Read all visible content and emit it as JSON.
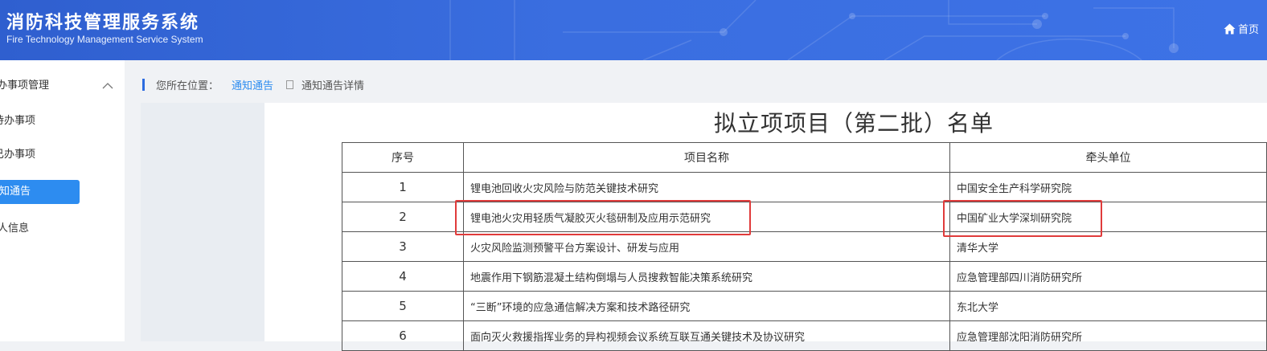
{
  "header": {
    "title": "消防科技管理服务系统",
    "subtitle": "Fire Technology Management Service System",
    "home_label": "首页",
    "home_icon": "home-icon"
  },
  "sidebar": {
    "group_label": "办事项管理",
    "items": [
      {
        "label": "待办事项",
        "active": false
      },
      {
        "label": "已办事项",
        "active": false
      },
      {
        "label": "通知通告",
        "active": true
      },
      {
        "label": "个人信息",
        "active": false
      }
    ],
    "visible_labels": [
      "办事项管理",
      "待办事项",
      "已办事项",
      "知通告",
      "人信息"
    ]
  },
  "breadcrumb": {
    "prefix": "您所在位置：",
    "link": "通知通告",
    "current": "通知通告详情"
  },
  "document": {
    "title": "拟立项项目（第二批）名单",
    "table": {
      "headers": [
        "序号",
        "项目名称",
        "牵头单位"
      ],
      "rows": [
        {
          "no": "1",
          "name": "锂电池回收火灾风险与防范关键技术研究",
          "org": "中国安全生产科学研究院"
        },
        {
          "no": "2",
          "name": "锂电池火灾用轻质气凝胶灭火毯研制及应用示范研究",
          "org": "中国矿业大学深圳研究院"
        },
        {
          "no": "3",
          "name": "火灾风险监测预警平台方案设计、研发与应用",
          "org": "清华大学"
        },
        {
          "no": "4",
          "name": "地震作用下钢筋混凝土结构倒塌与人员搜救智能决策系统研究",
          "org": "应急管理部四川消防研究所"
        },
        {
          "no": "5",
          "name": "“三断”环境的应急通信解决方案和技术路径研究",
          "org": "东北大学"
        },
        {
          "no": "6",
          "name": "面向灭火救援指挥业务的异构视频会议系统互联互通关键技术及协议研究",
          "org": "应急管理部沈阳消防研究所"
        }
      ]
    }
  },
  "colors": {
    "header_bg": "#3a6ee0",
    "active_item": "#2d8cf0",
    "highlight_box": "#e03b3b"
  }
}
